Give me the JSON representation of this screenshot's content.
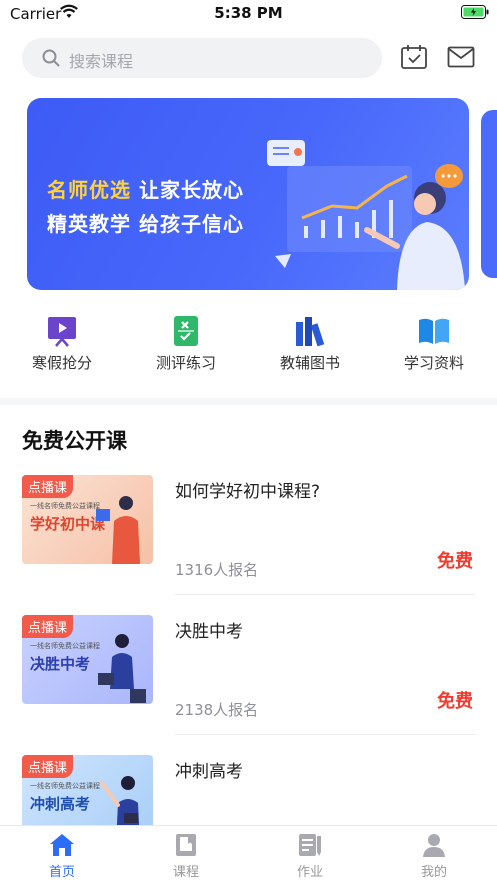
{
  "status_bar": {
    "carrier": "Carrier",
    "time": "5:38 PM"
  },
  "search": {
    "placeholder": "搜索课程"
  },
  "banner": {
    "line1_highlight": "名师优选",
    "line1_rest": "让家长放心",
    "line2": "精英教学  给孩子信心"
  },
  "quick_nav": [
    {
      "label": "寒假抢分",
      "icon": "presentation-play-icon"
    },
    {
      "label": "测评练习",
      "icon": "exercise-sheet-icon"
    },
    {
      "label": "教辅图书",
      "icon": "books-icon"
    },
    {
      "label": "学习资料",
      "icon": "open-book-icon"
    }
  ],
  "free_courses": {
    "title": "免费公开课",
    "items": [
      {
        "tag": "点播课",
        "thumb_sub": "一线名师免费公益课程",
        "thumb_title": "学好初中课",
        "title": "如何学好初中课程?",
        "count": "1316人报名",
        "price": "免费"
      },
      {
        "tag": "点播课",
        "thumb_sub": "一线名师免费公益课程",
        "thumb_title": "决胜中考",
        "title": "决胜中考",
        "count": "2138人报名",
        "price": "免费"
      },
      {
        "tag": "点播课",
        "thumb_sub": "一线名师免费公益课程",
        "thumb_title": "冲刺高考",
        "title": "冲刺高考",
        "count": "",
        "price": ""
      }
    ]
  },
  "tab_bar": [
    {
      "label": "首页",
      "icon": "home-icon",
      "active": true
    },
    {
      "label": "课程",
      "icon": "course-book-icon",
      "active": false
    },
    {
      "label": "作业",
      "icon": "homework-icon",
      "active": false
    },
    {
      "label": "我的",
      "icon": "profile-icon",
      "active": false
    }
  ],
  "colors": {
    "accent": "#2c6df7",
    "price": "#f03b2e",
    "banner": "#4868fb",
    "highlight": "#ffd43b"
  }
}
